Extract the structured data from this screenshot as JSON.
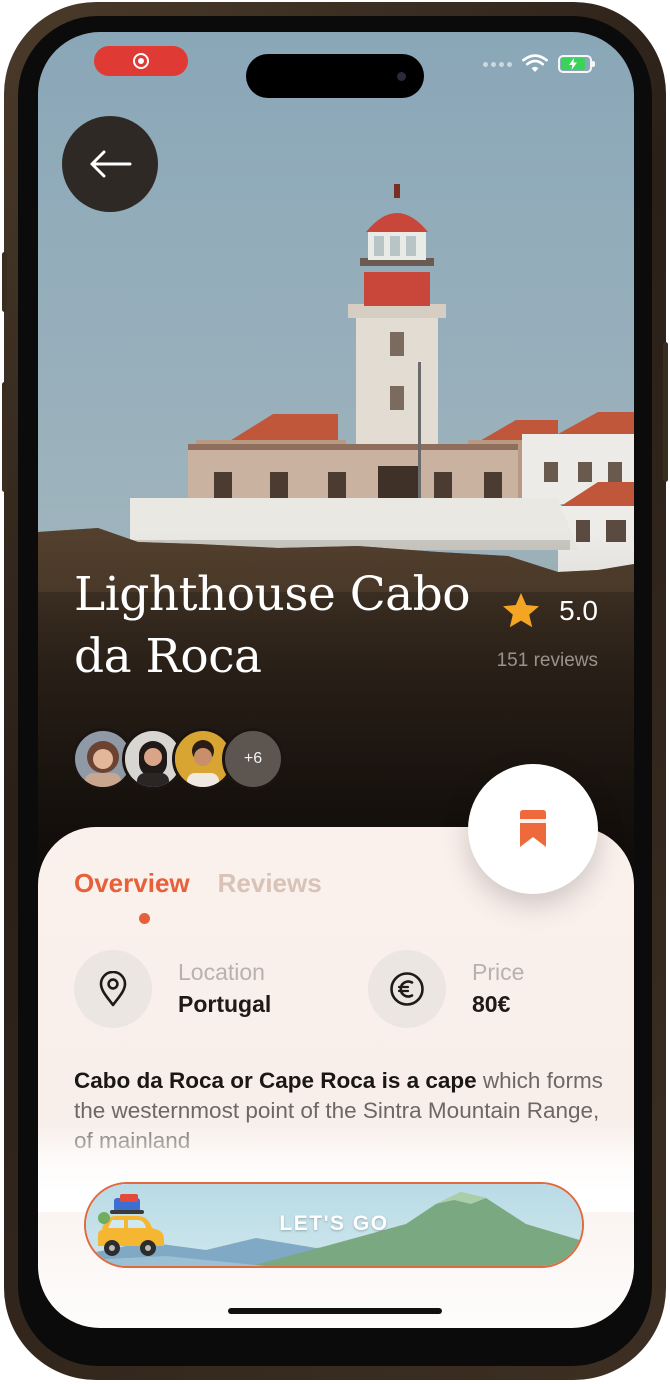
{
  "status_bar": {
    "recording_icon": "record-icon",
    "signal_icon": "cellular-signal-icon",
    "wifi_icon": "wifi-icon",
    "battery_icon": "battery-charging-icon",
    "battery_level": 0.85
  },
  "header": {
    "back_icon": "arrow-left-icon"
  },
  "place": {
    "title": "Lighthouse Cabo da Roca",
    "rating": "5.0",
    "reviews": "151 reviews",
    "visitors_more": "+6"
  },
  "actions": {
    "bookmark_icon": "bookmark-icon"
  },
  "tabs": [
    {
      "label": "Overview",
      "active": true
    },
    {
      "label": "Reviews",
      "active": false
    }
  ],
  "details": {
    "location_label": "Location",
    "location_value": "Portugal",
    "price_label": "Price",
    "price_value": "80€"
  },
  "description": {
    "lead": "Cabo da Roca or Cape Roca is a cape",
    "rest": "which forms the westernmost point of the Sintra Mountain Range, of mainland"
  },
  "cta": {
    "label": "LET'S GO"
  },
  "colors": {
    "accent": "#e8603a",
    "star": "#f5a524",
    "sheet_bg": "#faf0ec"
  }
}
